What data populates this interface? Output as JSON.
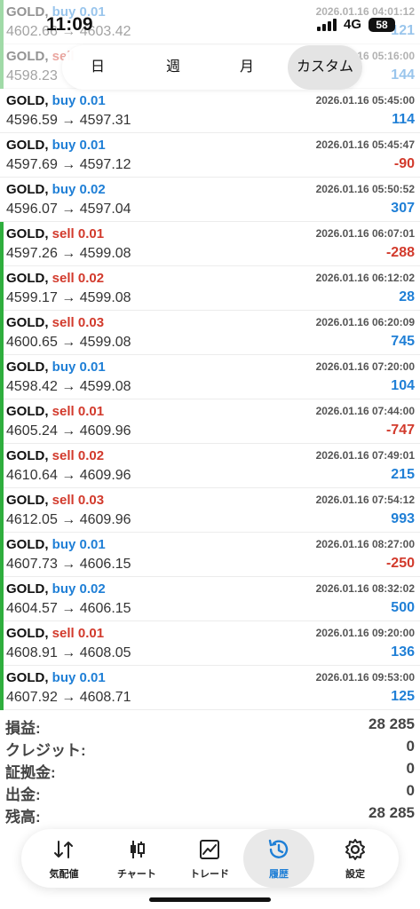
{
  "status_bar": {
    "time": "11:09",
    "network": "4G",
    "battery": "58"
  },
  "period_tabs": [
    {
      "label": "日",
      "active": false
    },
    {
      "label": "週",
      "active": false
    },
    {
      "label": "月",
      "active": false
    },
    {
      "label": "カスタム",
      "active": true
    }
  ],
  "deals": [
    {
      "symbol": "GOLD,",
      "side": "buy 0.01",
      "side_type": "buy",
      "prices": "4602.66 → 4603.42",
      "time": "2026.01.16 04:01:12",
      "profit": "121",
      "profit_sign": "pos",
      "faded": true
    },
    {
      "symbol": "GOLD,",
      "side": "sell",
      "side_type": "sell",
      "prices": "4598.23",
      "time": "16 05:16:00",
      "profit": "144",
      "profit_sign": "pos",
      "faded": true
    },
    {
      "symbol": "GOLD,",
      "side": "buy 0.01",
      "side_type": "buy",
      "prices": "4596.59 → 4597.31",
      "time": "2026.01.16 05:45:00",
      "profit": "114",
      "profit_sign": "pos",
      "faded": false
    },
    {
      "symbol": "GOLD,",
      "side": "buy 0.01",
      "side_type": "buy",
      "prices": "4597.69 → 4597.12",
      "time": "2026.01.16 05:45:47",
      "profit": "-90",
      "profit_sign": "neg",
      "faded": false
    },
    {
      "symbol": "GOLD,",
      "side": "buy 0.02",
      "side_type": "buy",
      "prices": "4596.07 → 4597.04",
      "time": "2026.01.16 05:50:52",
      "profit": "307",
      "profit_sign": "pos",
      "faded": false
    },
    {
      "symbol": "GOLD,",
      "side": "sell 0.01",
      "side_type": "sell",
      "prices": "4597.26 → 4599.08",
      "time": "2026.01.16 06:07:01",
      "profit": "-288",
      "profit_sign": "neg",
      "faded": false
    },
    {
      "symbol": "GOLD,",
      "side": "sell 0.02",
      "side_type": "sell",
      "prices": "4599.17 → 4599.08",
      "time": "2026.01.16 06:12:02",
      "profit": "28",
      "profit_sign": "pos",
      "faded": false
    },
    {
      "symbol": "GOLD,",
      "side": "sell 0.03",
      "side_type": "sell",
      "prices": "4600.65 → 4599.08",
      "time": "2026.01.16 06:20:09",
      "profit": "745",
      "profit_sign": "pos",
      "faded": false
    },
    {
      "symbol": "GOLD,",
      "side": "buy 0.01",
      "side_type": "buy",
      "prices": "4598.42 → 4599.08",
      "time": "2026.01.16 07:20:00",
      "profit": "104",
      "profit_sign": "pos",
      "faded": false
    },
    {
      "symbol": "GOLD,",
      "side": "sell 0.01",
      "side_type": "sell",
      "prices": "4605.24 → 4609.96",
      "time": "2026.01.16 07:44:00",
      "profit": "-747",
      "profit_sign": "neg",
      "faded": false
    },
    {
      "symbol": "GOLD,",
      "side": "sell 0.02",
      "side_type": "sell",
      "prices": "4610.64 → 4609.96",
      "time": "2026.01.16 07:49:01",
      "profit": "215",
      "profit_sign": "pos",
      "faded": false
    },
    {
      "symbol": "GOLD,",
      "side": "sell 0.03",
      "side_type": "sell",
      "prices": "4612.05 → 4609.96",
      "time": "2026.01.16 07:54:12",
      "profit": "993",
      "profit_sign": "pos",
      "faded": false
    },
    {
      "symbol": "GOLD,",
      "side": "buy 0.01",
      "side_type": "buy",
      "prices": "4607.73 → 4606.15",
      "time": "2026.01.16 08:27:00",
      "profit": "-250",
      "profit_sign": "neg",
      "faded": false
    },
    {
      "symbol": "GOLD,",
      "side": "buy 0.02",
      "side_type": "buy",
      "prices": "4604.57 → 4606.15",
      "time": "2026.01.16 08:32:02",
      "profit": "500",
      "profit_sign": "pos",
      "faded": false
    },
    {
      "symbol": "GOLD,",
      "side": "sell 0.01",
      "side_type": "sell",
      "prices": "4608.91 → 4608.05",
      "time": "2026.01.16 09:20:00",
      "profit": "136",
      "profit_sign": "pos",
      "faded": false
    },
    {
      "symbol": "GOLD,",
      "side": "buy 0.01",
      "side_type": "buy",
      "prices": "4607.92 → 4608.71",
      "time": "2026.01.16 09:53:00",
      "profit": "125",
      "profit_sign": "pos",
      "faded": false
    }
  ],
  "summary": [
    {
      "label": "損益:",
      "value": "28 285"
    },
    {
      "label": "クレジット:",
      "value": "0"
    },
    {
      "label": "証拠金:",
      "value": "0"
    },
    {
      "label": "出金:",
      "value": "0"
    },
    {
      "label": "残高:",
      "value": "28 285"
    }
  ],
  "bottom_nav": [
    {
      "label": "気配値",
      "icon": "quotes-arrows-icon",
      "active": false
    },
    {
      "label": "チャート",
      "icon": "candlestick-chart-icon",
      "active": false
    },
    {
      "label": "トレード",
      "icon": "trade-line-chart-icon",
      "active": false
    },
    {
      "label": "履歴",
      "icon": "history-clock-icon",
      "active": true
    },
    {
      "label": "設定",
      "icon": "gear-icon",
      "active": false
    }
  ],
  "colors": {
    "buy": "#1f7fd6",
    "sell": "#d23a2c",
    "accent_green": "#2fae3d",
    "active_tab_bg": "#e4e4e4"
  }
}
